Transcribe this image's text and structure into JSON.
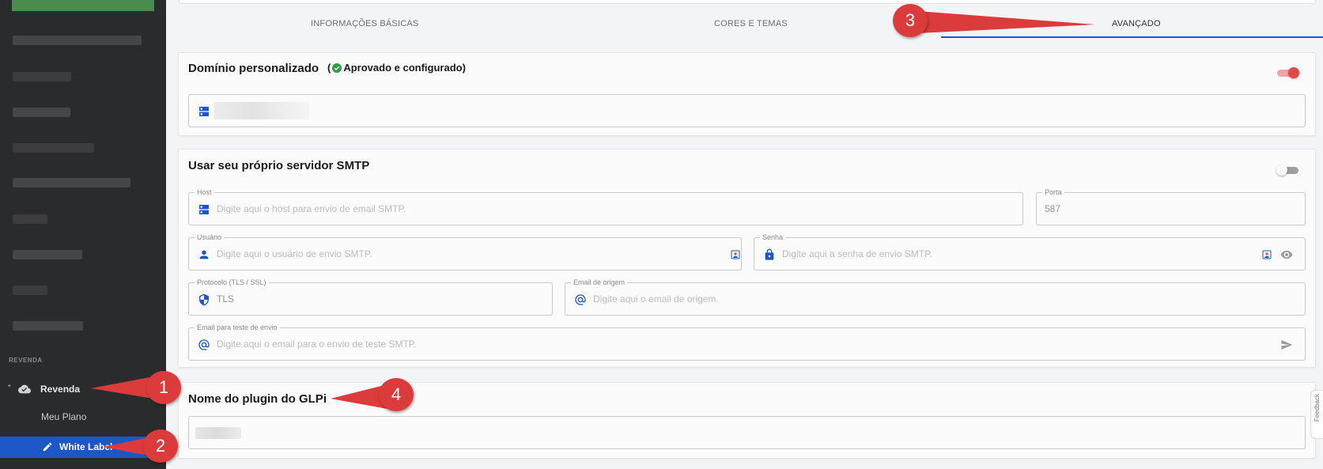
{
  "sidebar": {
    "section_label": "REVENDA",
    "revenda_label": "Revenda",
    "meu_plano_label": "Meu Plano",
    "white_label_label": "White Label"
  },
  "tabs": [
    {
      "label": "INFORMAÇÕES BÁSICAS"
    },
    {
      "label": "CORES E TEMAS"
    },
    {
      "label": "AVANÇADO"
    }
  ],
  "dominio": {
    "title": "Domínio personalizado",
    "status_open": "(",
    "status": "Aprovado e configurado)",
    "toggle_on": true
  },
  "smtp": {
    "title": "Usar seu próprio servidor SMTP",
    "toggle_on": false,
    "host": {
      "legend": "Host",
      "placeholder": "Digite aqui o host para envio de email SMTP."
    },
    "porta": {
      "legend": "Porta",
      "value": "587"
    },
    "usuario": {
      "legend": "Usuário",
      "placeholder": "Digite aqui o usuário de envio SMTP."
    },
    "senha": {
      "legend": "Senha",
      "placeholder": "Digite aqui a senha de envio SMTP."
    },
    "protocolo": {
      "legend": "Protocolo (TLS / SSL)",
      "value": "TLS"
    },
    "email_origem": {
      "legend": "Email de origem",
      "placeholder": "Digite aqui o email de origem."
    },
    "email_teste": {
      "legend": "Email para teste de envio",
      "placeholder": "Digite aqui o email para o envio de teste SMTP."
    }
  },
  "glpi": {
    "title": "Nome do plugin do GLPi"
  },
  "annotations": [
    "1",
    "2",
    "3",
    "4"
  ],
  "feedback_label": "Feedback",
  "colors": {
    "accent": "#1d56c6",
    "annotation": "#dc3b3b",
    "approved": "#2e9d48",
    "sidebar_bg": "#2a2b2c"
  }
}
